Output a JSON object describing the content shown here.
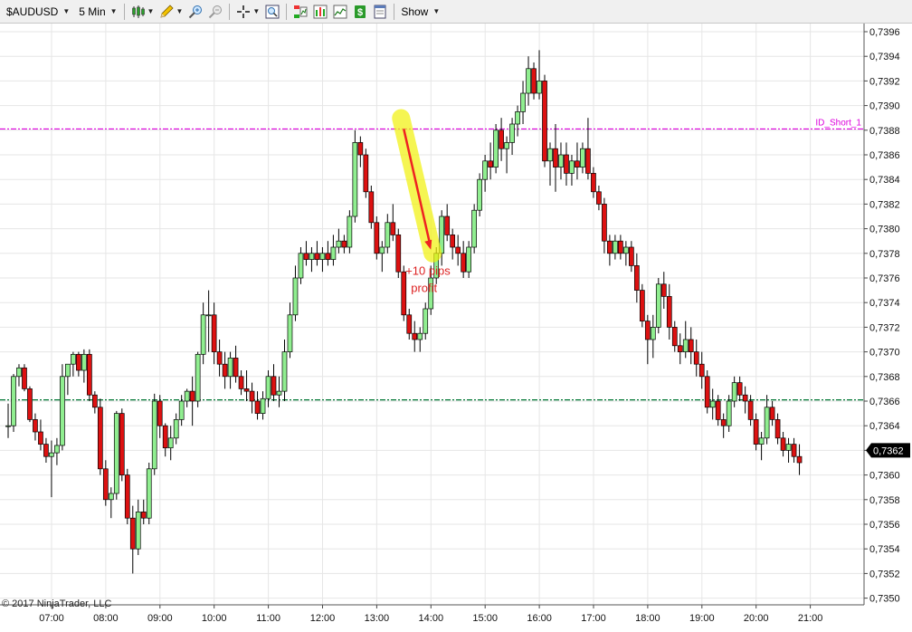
{
  "toolbar": {
    "instrument": "$AUDUSD",
    "interval": "5 Min",
    "show_label": "Show"
  },
  "copyright": "© 2017 NinjaTrader, LLC",
  "colors": {
    "up_candle": "#90ee90",
    "down_candle": "#dd1111",
    "short_line": "#dd00dd",
    "support_line": "#007733",
    "arrow": "#ee2222",
    "highlight": "#f2f20a",
    "price_tag_bg": "#000000"
  },
  "chart_data": {
    "type": "candlestick",
    "instrument": "$AUDUSD",
    "interval": "5 Min",
    "ylim": [
      0.73495,
      0.73965
    ],
    "y_ticks": [
      "0,7396",
      "0,7394",
      "0,7392",
      "0,7390",
      "0,7388",
      "0,7386",
      "0,7384",
      "0,7382",
      "0,7380",
      "0,7378",
      "0,7376",
      "0,7374",
      "0,7372",
      "0,7370",
      "0,7368",
      "0,7366",
      "0,7364",
      "0,7362",
      "0,7360",
      "0,7358",
      "0,7356",
      "0,7354",
      "0,7352",
      "0,7350"
    ],
    "x_ticks": [
      "07:00",
      "08:00",
      "09:00",
      "10:00",
      "11:00",
      "12:00",
      "13:00",
      "14:00",
      "15:00",
      "16:00",
      "17:00",
      "18:00",
      "19:00",
      "20:00",
      "21:00"
    ],
    "last_price": "0,7362",
    "horizontal_lines": [
      {
        "label": "ID_Short_1",
        "price": 0.73881,
        "style": "dash-dot",
        "color": "#dd00dd"
      },
      {
        "label": "",
        "price": 0.73661,
        "style": "dash-dot",
        "color": "#007733"
      }
    ],
    "annotation": {
      "text_line1": "+10 pips",
      "text_line2": "profit",
      "from_price": 0.73881,
      "to_price": 0.73783
    },
    "candles_ohlc": [
      [
        0.7364,
        0.73658,
        0.7363,
        0.7364
      ],
      [
        0.7364,
        0.73682,
        0.73635,
        0.7368
      ],
      [
        0.7368,
        0.7369,
        0.73672,
        0.73687
      ],
      [
        0.73687,
        0.7369,
        0.73668,
        0.7367
      ],
      [
        0.7367,
        0.73672,
        0.73643,
        0.73645
      ],
      [
        0.73645,
        0.7365,
        0.73628,
        0.73635
      ],
      [
        0.73635,
        0.73645,
        0.7362,
        0.73625
      ],
      [
        0.73625,
        0.7363,
        0.7361,
        0.73615
      ],
      [
        0.73615,
        0.73628,
        0.73582,
        0.73618
      ],
      [
        0.73618,
        0.7363,
        0.73608,
        0.73624
      ],
      [
        0.73624,
        0.7369,
        0.7362,
        0.7368
      ],
      [
        0.7368,
        0.7369,
        0.73665,
        0.7369
      ],
      [
        0.7369,
        0.737,
        0.7368,
        0.73698
      ],
      [
        0.73698,
        0.737,
        0.7368,
        0.73685
      ],
      [
        0.73685,
        0.73702,
        0.73675,
        0.73698
      ],
      [
        0.73698,
        0.73702,
        0.7366,
        0.73665
      ],
      [
        0.73665,
        0.73668,
        0.7365,
        0.73655
      ],
      [
        0.73655,
        0.73662,
        0.736,
        0.73605
      ],
      [
        0.73605,
        0.73612,
        0.73575,
        0.7358
      ],
      [
        0.7358,
        0.7359,
        0.73565,
        0.73585
      ],
      [
        0.73585,
        0.73652,
        0.7358,
        0.7365
      ],
      [
        0.7365,
        0.73654,
        0.73595,
        0.736
      ],
      [
        0.736,
        0.73605,
        0.7356,
        0.73565
      ],
      [
        0.73565,
        0.73575,
        0.7352,
        0.7354
      ],
      [
        0.7354,
        0.7358,
        0.73535,
        0.7357
      ],
      [
        0.7357,
        0.7358,
        0.7356,
        0.73565
      ],
      [
        0.73565,
        0.7361,
        0.7356,
        0.73605
      ],
      [
        0.73605,
        0.73666,
        0.736,
        0.7366
      ],
      [
        0.7366,
        0.73665,
        0.7363,
        0.7364
      ],
      [
        0.7364,
        0.73642,
        0.73615,
        0.73622
      ],
      [
        0.73622,
        0.7364,
        0.73612,
        0.7363
      ],
      [
        0.7363,
        0.7365,
        0.73625,
        0.73645
      ],
      [
        0.73645,
        0.73665,
        0.7364,
        0.7366
      ],
      [
        0.7366,
        0.7367,
        0.73655,
        0.73668
      ],
      [
        0.73668,
        0.7368,
        0.7364,
        0.7366
      ],
      [
        0.7366,
        0.737,
        0.73655,
        0.73698
      ],
      [
        0.73698,
        0.7374,
        0.7369,
        0.7373
      ],
      [
        0.7373,
        0.7375,
        0.737,
        0.7373
      ],
      [
        0.7373,
        0.7374,
        0.7369,
        0.737
      ],
      [
        0.737,
        0.7371,
        0.7368,
        0.7369
      ],
      [
        0.7369,
        0.737,
        0.7367,
        0.7368
      ],
      [
        0.7368,
        0.737,
        0.7367,
        0.73695
      ],
      [
        0.73695,
        0.73705,
        0.73675,
        0.7368
      ],
      [
        0.7368,
        0.73685,
        0.73665,
        0.7367
      ],
      [
        0.7367,
        0.73685,
        0.7366,
        0.73668
      ],
      [
        0.73668,
        0.73675,
        0.7365,
        0.7366
      ],
      [
        0.7366,
        0.73668,
        0.73645,
        0.7365
      ],
      [
        0.7365,
        0.73668,
        0.73645,
        0.73662
      ],
      [
        0.73662,
        0.73685,
        0.73655,
        0.7368
      ],
      [
        0.7368,
        0.7369,
        0.7366,
        0.73665
      ],
      [
        0.73665,
        0.7368,
        0.73655,
        0.73668
      ],
      [
        0.73668,
        0.7371,
        0.7366,
        0.737
      ],
      [
        0.737,
        0.7374,
        0.73695,
        0.7373
      ],
      [
        0.7373,
        0.7377,
        0.73725,
        0.7376
      ],
      [
        0.7376,
        0.73785,
        0.73755,
        0.7378
      ],
      [
        0.7378,
        0.7379,
        0.7377,
        0.73775
      ],
      [
        0.73775,
        0.73785,
        0.73765,
        0.7378
      ],
      [
        0.7378,
        0.7379,
        0.7377,
        0.73775
      ],
      [
        0.73775,
        0.73785,
        0.73765,
        0.7378
      ],
      [
        0.7378,
        0.7379,
        0.7377,
        0.73775
      ],
      [
        0.73775,
        0.73795,
        0.7377,
        0.73785
      ],
      [
        0.73785,
        0.738,
        0.7378,
        0.7379
      ],
      [
        0.7379,
        0.73795,
        0.7378,
        0.73785
      ],
      [
        0.73785,
        0.73815,
        0.7378,
        0.7381
      ],
      [
        0.7381,
        0.7388,
        0.73805,
        0.7387
      ],
      [
        0.7387,
        0.73875,
        0.7385,
        0.7386
      ],
      [
        0.7386,
        0.73865,
        0.73825,
        0.7383
      ],
      [
        0.7383,
        0.73835,
        0.738,
        0.73805
      ],
      [
        0.73805,
        0.7381,
        0.73775,
        0.7378
      ],
      [
        0.7378,
        0.7379,
        0.73765,
        0.73785
      ],
      [
        0.73785,
        0.73812,
        0.7378,
        0.73805
      ],
      [
        0.73805,
        0.7382,
        0.7379,
        0.73795
      ],
      [
        0.73795,
        0.738,
        0.7376,
        0.73765
      ],
      [
        0.73765,
        0.7377,
        0.73725,
        0.7373
      ],
      [
        0.7373,
        0.73735,
        0.7371,
        0.73715
      ],
      [
        0.73715,
        0.73725,
        0.737,
        0.7371
      ],
      [
        0.7371,
        0.7372,
        0.737,
        0.73715
      ],
      [
        0.73715,
        0.7374,
        0.7371,
        0.73735
      ],
      [
        0.73735,
        0.7377,
        0.7373,
        0.7376
      ],
      [
        0.7376,
        0.73785,
        0.73755,
        0.7378
      ],
      [
        0.7378,
        0.73815,
        0.7377,
        0.7381
      ],
      [
        0.7381,
        0.7382,
        0.7379,
        0.73795
      ],
      [
        0.73795,
        0.738,
        0.73775,
        0.73785
      ],
      [
        0.73785,
        0.73795,
        0.7377,
        0.7378
      ],
      [
        0.7378,
        0.7379,
        0.7376,
        0.73765
      ],
      [
        0.73765,
        0.7379,
        0.7376,
        0.73785
      ],
      [
        0.73785,
        0.7382,
        0.7378,
        0.73815
      ],
      [
        0.73815,
        0.73845,
        0.7381,
        0.7384
      ],
      [
        0.7384,
        0.7386,
        0.7383,
        0.73855
      ],
      [
        0.73855,
        0.7387,
        0.7384,
        0.7385
      ],
      [
        0.7385,
        0.73885,
        0.73845,
        0.7388
      ],
      [
        0.7388,
        0.7389,
        0.73855,
        0.73865
      ],
      [
        0.73865,
        0.73875,
        0.73845,
        0.7387
      ],
      [
        0.7387,
        0.7389,
        0.7386,
        0.73885
      ],
      [
        0.73885,
        0.739,
        0.73875,
        0.73895
      ],
      [
        0.73895,
        0.7392,
        0.73885,
        0.7391
      ],
      [
        0.7391,
        0.7394,
        0.739,
        0.7393
      ],
      [
        0.7393,
        0.73935,
        0.73905,
        0.7391
      ],
      [
        0.7391,
        0.73945,
        0.73905,
        0.7392
      ],
      [
        0.7392,
        0.73925,
        0.7385,
        0.73855
      ],
      [
        0.73855,
        0.7387,
        0.73835,
        0.73865
      ],
      [
        0.73865,
        0.73885,
        0.7383,
        0.7385
      ],
      [
        0.7385,
        0.7387,
        0.7384,
        0.7386
      ],
      [
        0.7386,
        0.7387,
        0.73835,
        0.73845
      ],
      [
        0.73845,
        0.7386,
        0.73835,
        0.73855
      ],
      [
        0.73855,
        0.7387,
        0.7384,
        0.7385
      ],
      [
        0.7385,
        0.7387,
        0.73845,
        0.73865
      ],
      [
        0.73865,
        0.7389,
        0.7384,
        0.73845
      ],
      [
        0.73845,
        0.7385,
        0.73825,
        0.7383
      ],
      [
        0.7383,
        0.73835,
        0.73815,
        0.7382
      ],
      [
        0.7382,
        0.73825,
        0.7378,
        0.7379
      ],
      [
        0.7379,
        0.73795,
        0.7377,
        0.7378
      ],
      [
        0.7378,
        0.73795,
        0.73775,
        0.7379
      ],
      [
        0.7379,
        0.73795,
        0.73775,
        0.7378
      ],
      [
        0.7378,
        0.7379,
        0.7377,
        0.73785
      ],
      [
        0.73785,
        0.7379,
        0.73765,
        0.7377
      ],
      [
        0.7377,
        0.7378,
        0.7374,
        0.7375
      ],
      [
        0.7375,
        0.73755,
        0.7372,
        0.73725
      ],
      [
        0.73725,
        0.7373,
        0.7369,
        0.7371
      ],
      [
        0.7371,
        0.7373,
        0.73695,
        0.7372
      ],
      [
        0.7372,
        0.7376,
        0.73715,
        0.73755
      ],
      [
        0.73755,
        0.73765,
        0.73735,
        0.73745
      ],
      [
        0.73745,
        0.73755,
        0.7371,
        0.7372
      ],
      [
        0.7372,
        0.73725,
        0.737,
        0.73705
      ],
      [
        0.73705,
        0.73715,
        0.7369,
        0.737
      ],
      [
        0.737,
        0.73725,
        0.73695,
        0.7371
      ],
      [
        0.7371,
        0.7372,
        0.7369,
        0.737
      ],
      [
        0.737,
        0.7371,
        0.7368,
        0.7369
      ],
      [
        0.7369,
        0.737,
        0.7367,
        0.7368
      ],
      [
        0.7368,
        0.73685,
        0.7365,
        0.73655
      ],
      [
        0.73655,
        0.7367,
        0.73645,
        0.7366
      ],
      [
        0.7366,
        0.73665,
        0.7364,
        0.73645
      ],
      [
        0.73645,
        0.7365,
        0.7363,
        0.7364
      ],
      [
        0.7364,
        0.73665,
        0.73635,
        0.7366
      ],
      [
        0.7366,
        0.7368,
        0.73655,
        0.73675
      ],
      [
        0.73675,
        0.7368,
        0.7366,
        0.73665
      ],
      [
        0.73665,
        0.73672,
        0.7365,
        0.7366
      ],
      [
        0.7366,
        0.73665,
        0.7364,
        0.73645
      ],
      [
        0.73645,
        0.7365,
        0.7362,
        0.73625
      ],
      [
        0.73625,
        0.73635,
        0.73612,
        0.7363
      ],
      [
        0.7363,
        0.73665,
        0.73625,
        0.73655
      ],
      [
        0.73655,
        0.7366,
        0.7364,
        0.73645
      ],
      [
        0.73645,
        0.7365,
        0.73625,
        0.7363
      ],
      [
        0.7363,
        0.73635,
        0.73615,
        0.7362
      ],
      [
        0.7362,
        0.7363,
        0.7361,
        0.73625
      ],
      [
        0.73625,
        0.7363,
        0.7361,
        0.73615
      ],
      [
        0.73615,
        0.73625,
        0.736,
        0.7361
      ]
    ]
  }
}
